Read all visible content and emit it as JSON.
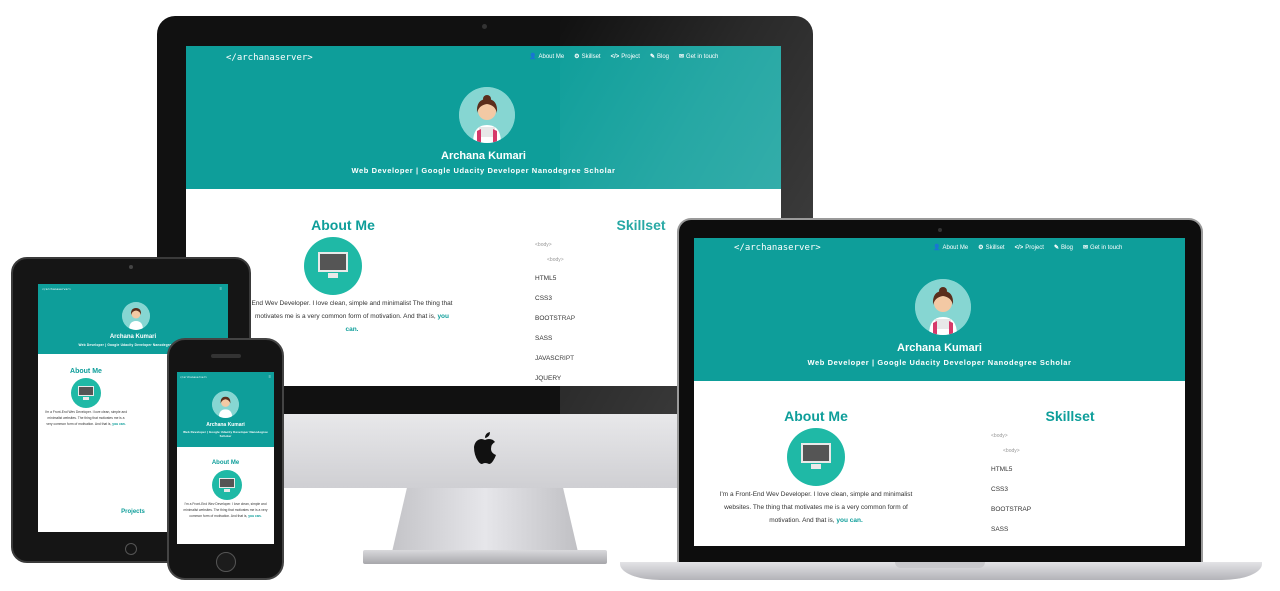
{
  "site": {
    "brand": "</archanaserver>",
    "nav": [
      {
        "icon": "user-icon",
        "glyph": "👤",
        "label": "About Me"
      },
      {
        "icon": "cogs-icon",
        "glyph": "⚙",
        "label": "Skillset"
      },
      {
        "icon": "code-icon",
        "glyph": "</>",
        "label": "Project"
      },
      {
        "icon": "edit-icon",
        "glyph": "✎",
        "label": "Blog"
      },
      {
        "icon": "envelope-icon",
        "glyph": "✉",
        "label": "Get in touch"
      }
    ],
    "name": "Archana Kumari",
    "tagline": "Web Developer | Google Udacity Developer Nanodegree Scholar",
    "about_title": "About Me",
    "about_text_desktop": "End Wev Developer. I love clean, simple and minimalist The thing that motivates me is a very common form of motivation. And that is,",
    "about_text": "I'm a Front-End Wev Developer. I love clean, simple and minimalist websites. The thing that motivates me is a very common form of motivation. And that is,",
    "about_highlight": "you can.",
    "skills_title": "Skillset",
    "skill_tags": [
      "<body>",
      "<body>"
    ],
    "skills": [
      "HTML5",
      "CSS3",
      "BOOTSTRAP",
      "SASS",
      "JAVASCRIPT",
      "JQUERY"
    ],
    "projects_title": "Projects"
  },
  "colors": {
    "hero": "#0e9e9a",
    "accent": "#1fb9a6"
  }
}
